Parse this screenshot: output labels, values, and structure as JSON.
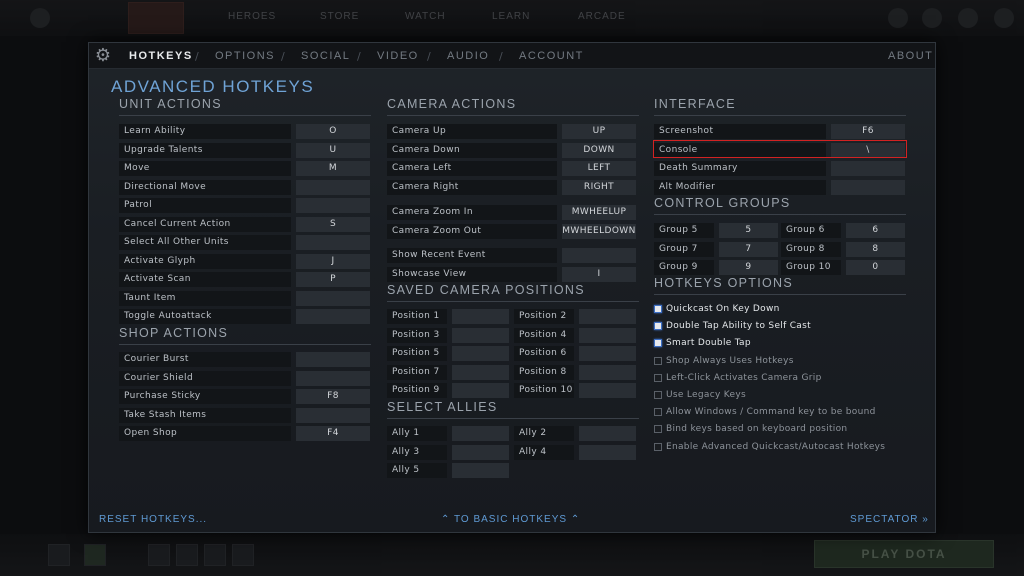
{
  "background": {
    "top_tabs": [
      "HEROES",
      "STORE",
      "WATCH",
      "LEARN",
      "ARCADE"
    ],
    "play_button": "PLAY DOTA"
  },
  "nav": {
    "items": [
      "HOTKEYS",
      "OPTIONS",
      "SOCIAL",
      "VIDEO",
      "AUDIO",
      "ACCOUNT"
    ],
    "separator": "/",
    "about": "ABOUT"
  },
  "page_title": "ADVANCED HOTKEYS",
  "unit_actions": {
    "title": "UNIT ACTIONS",
    "rows": [
      {
        "label": "Learn Ability",
        "key": "O"
      },
      {
        "label": "Upgrade Talents",
        "key": "U"
      },
      {
        "label": "Move",
        "key": "M"
      },
      {
        "label": "Directional Move",
        "key": ""
      },
      {
        "label": "Patrol",
        "key": ""
      },
      {
        "label": "Cancel Current Action",
        "key": "S"
      },
      {
        "label": "Select All Other Units",
        "key": ""
      },
      {
        "label": "Activate Glyph",
        "key": "J"
      },
      {
        "label": "Activate Scan",
        "key": "P"
      },
      {
        "label": "Taunt Item",
        "key": ""
      },
      {
        "label": "Toggle Autoattack",
        "key": ""
      }
    ]
  },
  "shop_actions": {
    "title": "SHOP ACTIONS",
    "rows": [
      {
        "label": "Courier Burst",
        "key": ""
      },
      {
        "label": "Courier Shield",
        "key": ""
      },
      {
        "label": "Purchase Sticky",
        "key": "F8"
      },
      {
        "label": "Take Stash Items",
        "key": ""
      },
      {
        "label": "Open Shop",
        "key": "F4"
      }
    ]
  },
  "camera_actions": {
    "title": "CAMERA ACTIONS",
    "rows": [
      {
        "label": "Camera Up",
        "key": "UP"
      },
      {
        "label": "Camera Down",
        "key": "DOWN"
      },
      {
        "label": "Camera Left",
        "key": "LEFT"
      },
      {
        "label": "Camera Right",
        "key": "RIGHT"
      },
      {
        "label": "Camera Zoom In",
        "key": "MWHEELUP"
      },
      {
        "label": "Camera Zoom Out",
        "key": "MWHEELDOWN"
      },
      {
        "label": "Show Recent Event",
        "key": ""
      },
      {
        "label": "Showcase View",
        "key": "I"
      }
    ]
  },
  "saved_camera": {
    "title": "SAVED CAMERA POSITIONS",
    "left": [
      "Position 1",
      "Position 3",
      "Position 5",
      "Position 7",
      "Position 9"
    ],
    "right": [
      "Position 2",
      "Position 4",
      "Position 6",
      "Position 8",
      "Position 10"
    ]
  },
  "select_allies": {
    "title": "SELECT ALLIES",
    "left": [
      "Ally 1",
      "Ally 3",
      "Ally 5"
    ],
    "right": [
      "Ally 2",
      "Ally 4"
    ]
  },
  "interface": {
    "title": "INTERFACE",
    "rows": [
      {
        "label": "Screenshot",
        "key": "F6"
      },
      {
        "label": "Console",
        "key": "\\"
      },
      {
        "label": "Death Summary",
        "key": ""
      },
      {
        "label": "Alt Modifier",
        "key": ""
      }
    ]
  },
  "control_groups": {
    "title": "CONTROL GROUPS",
    "left": [
      {
        "label": "Group 5",
        "key": "5"
      },
      {
        "label": "Group 7",
        "key": "7"
      },
      {
        "label": "Group 9",
        "key": "9"
      }
    ],
    "right": [
      {
        "label": "Group 6",
        "key": "6"
      },
      {
        "label": "Group 8",
        "key": "8"
      },
      {
        "label": "Group 10",
        "key": "0"
      }
    ]
  },
  "hotkeys_options": {
    "title": "HOTKEYS OPTIONS",
    "items": [
      {
        "label": "Quickcast On Key Down",
        "checked": true
      },
      {
        "label": "Double Tap Ability to Self Cast",
        "checked": true
      },
      {
        "label": "Smart Double Tap",
        "checked": true
      },
      {
        "label": "Shop Always Uses Hotkeys",
        "checked": false
      },
      {
        "label": "Left-Click Activates Camera Grip",
        "checked": false
      },
      {
        "label": "Use Legacy Keys",
        "checked": false
      },
      {
        "label": "Allow Windows / Command key to be bound",
        "checked": false
      },
      {
        "label": "Bind keys based on keyboard position",
        "checked": false
      },
      {
        "label": "Enable Advanced Quickcast/Autocast Hotkeys",
        "checked": false
      }
    ]
  },
  "footer": {
    "reset": "RESET HOTKEYS...",
    "basic": "TO BASIC HOTKEYS",
    "spectator": "SPECTATOR"
  }
}
